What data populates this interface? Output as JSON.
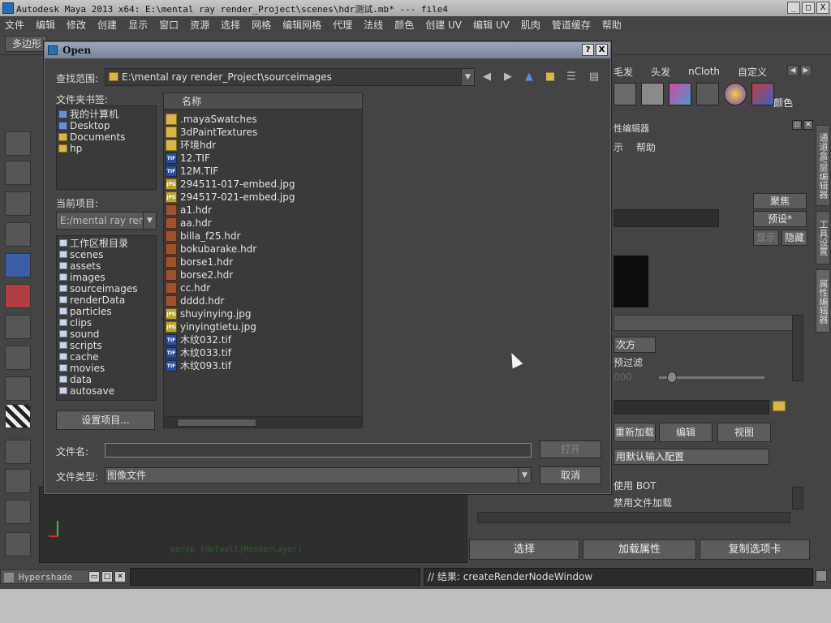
{
  "app": {
    "title": "Autodesk Maya 2013 x64: E:\\mental ray render_Project\\scenes\\hdr测试.mb*   ---   file4",
    "window_buttons": [
      "_",
      "□",
      "X"
    ]
  },
  "menubar": [
    "文件",
    "编辑",
    "修改",
    "创建",
    "显示",
    "窗口",
    "资源",
    "选择",
    "网格",
    "编辑网格",
    "代理",
    "法线",
    "颜色",
    "创建 UV",
    "编辑 UV",
    "肌肉",
    "管道缓存",
    "帮助"
  ],
  "mode_selector": "多边形",
  "shelf": {
    "tabs": [
      "毛发",
      "头发",
      "nCloth",
      "自定义"
    ],
    "color_label": "颜色"
  },
  "attribute_editor": {
    "title": "性编辑器",
    "menu": [
      "示",
      "帮助"
    ],
    "focus_button": "聚焦",
    "presets_button": "预设*",
    "show_button": "显示",
    "hide_button": "隐藏",
    "filter_type": "次方",
    "prefilter_label": "预过滤",
    "filter_value": "000",
    "reload_button": "重新加载",
    "edit_button": "编辑",
    "view_button": "视图",
    "color_profile": "用默认输入配置",
    "use_bot": "使用 BOT",
    "disable_file_load": "禁用文件加载",
    "select_button": "选择",
    "load_attributes_button": "加载属性",
    "copy_tab_button": "复制选项卡"
  },
  "side_tabs": [
    "通道盒/层编辑器",
    "工具设置",
    "属性编辑器"
  ],
  "viewport": {
    "camera_label": "persp (default|RenderLayer)"
  },
  "statusbar": {
    "panel_name": "Hypershade",
    "result_text": "// 结果: createRenderNodeWindow"
  },
  "dialog": {
    "title": "Open",
    "title_buttons": [
      "?",
      "X"
    ],
    "look_in_label": "查找范围:",
    "look_in_path": "E:\\mental ray render_Project\\sourceimages",
    "bookmarks_label": "文件夹书签:",
    "bookmarks": [
      "我的计算机",
      "Desktop",
      "Documents",
      "hp"
    ],
    "current_project_label": "当前项目:",
    "current_project": "E:/mental ray render_Project",
    "project_dirs": [
      "工作区根目录",
      "scenes",
      "assets",
      "images",
      "sourceimages",
      "renderData",
      "particles",
      "clips",
      "sound",
      "scripts",
      "cache",
      "movies",
      "data",
      "autosave"
    ],
    "set_project_button": "设置项目...",
    "column_header": "名称",
    "files": [
      {
        "name": ".mayaSwatches",
        "type": "folder"
      },
      {
        "name": "3dPaintTextures",
        "type": "folder"
      },
      {
        "name": "环境hdr",
        "type": "folder"
      },
      {
        "name": "12.TIF",
        "type": "tif"
      },
      {
        "name": "12M.TIF",
        "type": "tif"
      },
      {
        "name": "294511-017-embed.jpg",
        "type": "jpg"
      },
      {
        "name": "294517-021-embed.jpg",
        "type": "jpg"
      },
      {
        "name": "a1.hdr",
        "type": "hdr"
      },
      {
        "name": "aa.hdr",
        "type": "hdr"
      },
      {
        "name": "billa_f25.hdr",
        "type": "hdr"
      },
      {
        "name": "bokubarake.hdr",
        "type": "hdr"
      },
      {
        "name": "borse1.hdr",
        "type": "hdr"
      },
      {
        "name": "borse2.hdr",
        "type": "hdr"
      },
      {
        "name": "cc.hdr",
        "type": "hdr"
      },
      {
        "name": "dddd.hdr",
        "type": "hdr"
      },
      {
        "name": "shuyinying.jpg",
        "type": "jpg"
      },
      {
        "name": "yinyingtietu.jpg",
        "type": "jpg"
      },
      {
        "name": "木纹032.tif",
        "type": "tif"
      },
      {
        "name": "木纹033.tif",
        "type": "tif"
      },
      {
        "name": "木纹093.tif",
        "type": "tif"
      }
    ],
    "file_name_label": "文件名:",
    "file_name_value": "",
    "file_type_label": "文件类型:",
    "file_type_value": "图像文件",
    "open_button": "打开",
    "cancel_button": "取消"
  }
}
